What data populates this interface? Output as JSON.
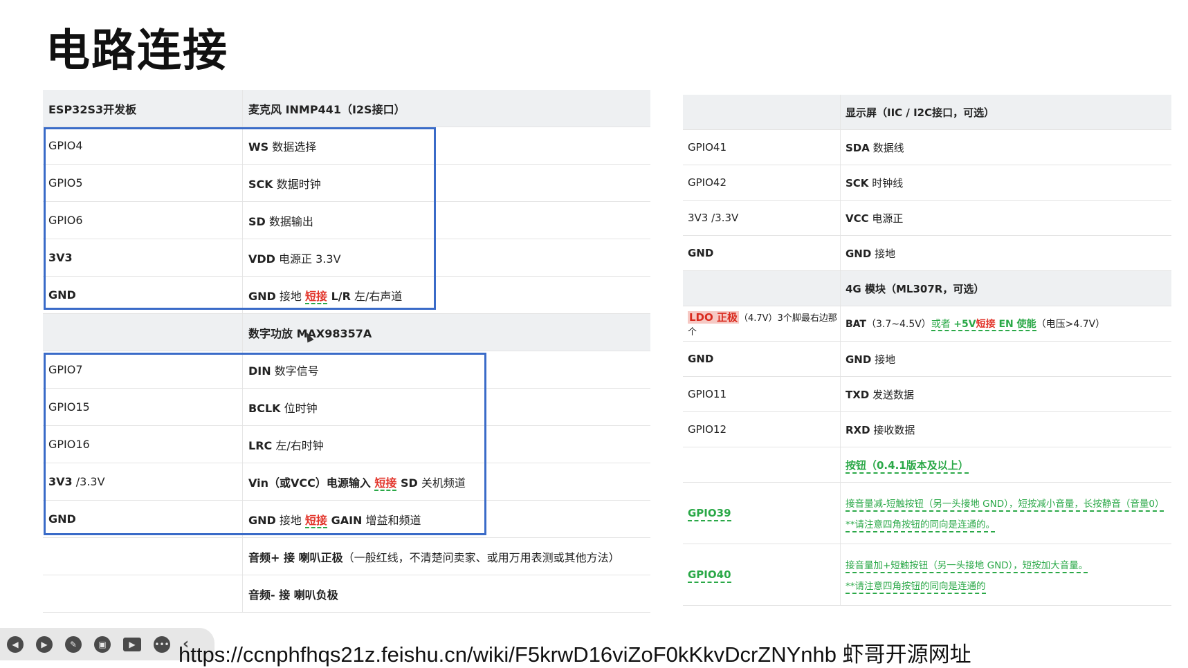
{
  "page": {
    "title": "电路连接"
  },
  "left_table": {
    "header": {
      "c1": "ESP32S3开发板",
      "c2": "麦克风 INMP441（I2S接口）"
    },
    "mic_rows": [
      {
        "c1": "GPIO4",
        "c2_main": "WS",
        "c2_rest": " 数据选择"
      },
      {
        "c1": "GPIO5",
        "c2_main": "SCK",
        "c2_rest": " 数据时钟"
      },
      {
        "c1": "GPIO6",
        "c2_main": "SD",
        "c2_rest": " 数据输出"
      },
      {
        "c1": "3V3",
        "c2_main": "VDD",
        "c2_rest": " 电源正 3.3V"
      }
    ],
    "mic_gnd": {
      "c1": "GND",
      "a": "GND",
      "b": " 接地 ",
      "red": "短接",
      "c": " L/R",
      "d": " 左/右声道"
    },
    "amp_header": {
      "c1": "",
      "c2": "数字功放 MAX98357A"
    },
    "amp_rows": [
      {
        "c1": "GPIO7",
        "c2_main": "DIN",
        "c2_rest": " 数字信号"
      },
      {
        "c1": "GPIO15",
        "c2_main": "BCLK",
        "c2_rest": " 位时钟"
      },
      {
        "c1": "GPIO16",
        "c2_main": "LRC",
        "c2_rest": " 左/右时钟"
      }
    ],
    "amp_vin": {
      "c1a": "3V3",
      "c1b": " /3.3V",
      "a": "Vin（或VCC）电源输入 ",
      "red": "短接",
      "c": " SD",
      "d": " 关机频道"
    },
    "amp_gnd": {
      "c1": "GND",
      "a": "GND",
      "b": " 接地 ",
      "red": "短接",
      "c": " GAIN",
      "d": " 增益和频道"
    },
    "speaker_rows": [
      {
        "c1": "",
        "a": "音频+ 接 ",
        "b": "喇叭正极",
        "c": "（一般红线，不清楚问卖家、或用万用表测或其他方法）"
      },
      {
        "c1": "",
        "a": "音频- 接 ",
        "b": "喇叭负极",
        "c": ""
      }
    ]
  },
  "right_table": {
    "header": {
      "c1": "",
      "c2": "显示屏（IIC / I2C接口，可选）"
    },
    "display_rows": [
      {
        "c1": "GPIO41",
        "c2_main": "SDA",
        "c2_rest": " 数据线"
      },
      {
        "c1": "GPIO42",
        "c2_main": "SCK",
        "c2_rest": " 时钟线"
      },
      {
        "c1": "3V3 /3.3V",
        "c2_main": "VCC",
        "c2_rest": " 电源正"
      },
      {
        "c1": "GND",
        "c2_main": "GND",
        "c2_rest": " 接地"
      }
    ],
    "module_header": {
      "c1": "",
      "c2": "4G 模块（ML307R，可选）"
    },
    "bat_row": {
      "c1_red": "LDO 正极",
      "c1_rest": "（4.7V）3个脚最右边那个",
      "c2_a": "BAT",
      "c2_b": "（3.7~4.5V）",
      "c2_green1": "或者 ",
      "c2_green2": "+5V",
      "c2_red": "短接",
      "c2_green3": " EN 使能",
      "c2_c": "（电压>4.7V）"
    },
    "module_rows": [
      {
        "c1": "GND",
        "c2_main": "GND",
        "c2_rest": " 接地"
      },
      {
        "c1": "GPIO11",
        "c2_main": "TXD",
        "c2_rest": " 发送数据"
      },
      {
        "c1": "GPIO12",
        "c2_main": "RXD",
        "c2_rest": " 接收数据"
      }
    ],
    "button_header": {
      "c1": "",
      "c2": "按钮（0.4.1版本及以上）"
    },
    "button_rows": [
      {
        "c1": "GPIO39",
        "line1": "接音量减-短触按钮（另一头接地 GND），短按减小音量，长按静音（音量0）",
        "line2": "**请注意四角按钮的同向是连通的。"
      },
      {
        "c1": "GPIO40",
        "line1": "接音量加+短触按钮（另一头接地 GND），短按加大音量。",
        "line2": "**请注意四角按钮的同向是连通的"
      }
    ]
  },
  "toolbar": {
    "icons": [
      "back-icon",
      "play-icon",
      "pen-icon",
      "screenshot-icon",
      "camera-icon",
      "more-icon",
      "collapse-icon"
    ]
  },
  "caption": "https://ccnphfhqs21z.feishu.cn/wiki/F5krwD16viZoF0kKkvDcrZNYnhb  虾哥开源网址"
}
